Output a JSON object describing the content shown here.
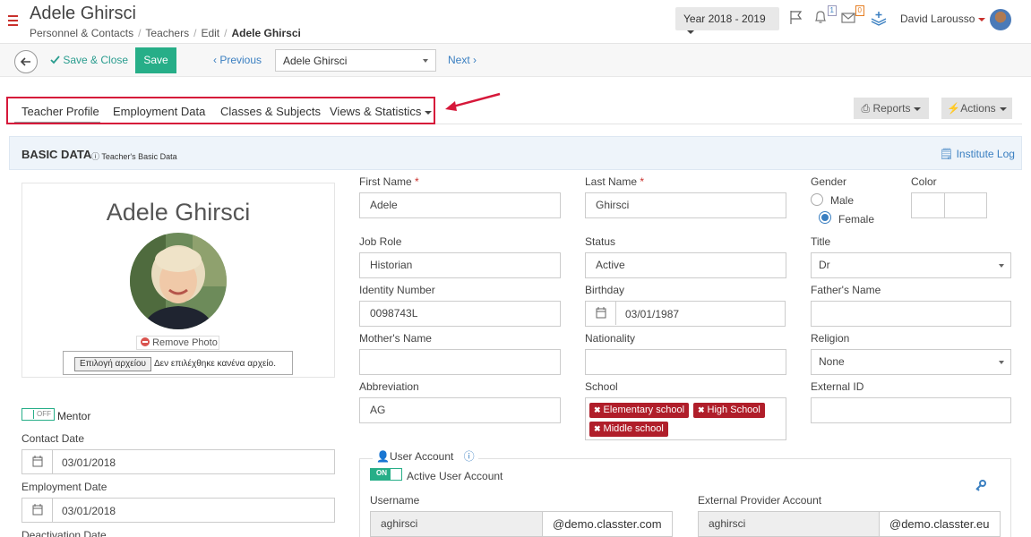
{
  "header": {
    "title": "Adele Ghirsci",
    "breadcrumb": [
      "Personnel & Contacts",
      "Teachers",
      "Edit",
      "Adele Ghirsci"
    ],
    "year_select": "Year 2018 - 2019",
    "notifications_count": "1",
    "messages_count": "0",
    "user_name": "David Larousso"
  },
  "toolbar": {
    "save_close_label": "Save & Close",
    "save_label": "Save",
    "previous_label": "Previous",
    "record_select_value": "Adele Ghirsci",
    "next_label": "Next"
  },
  "tabs": [
    {
      "label": "Teacher Profile",
      "active": true
    },
    {
      "label": "Employment Data",
      "active": false
    },
    {
      "label": "Classes & Subjects",
      "active": false
    },
    {
      "label": "Views & Statistics",
      "active": false
    }
  ],
  "buttons": {
    "reports": "Reports",
    "actions": "Actions"
  },
  "section": {
    "title": "BASIC DATA",
    "subtitle": "Teacher's Basic Data",
    "institute_log": "Institute Log"
  },
  "profile": {
    "name": "Adele Ghirsci",
    "remove_photo": "Remove Photo",
    "file_button": "Επιλογή αρχείου",
    "file_status": "Δεν επιλέχθηκε κανένα αρχείο.",
    "mentor_toggle": "OFF",
    "mentor_label": "Mentor",
    "contact_date_label": "Contact Date",
    "contact_date": "03/01/2018",
    "employment_date_label": "Employment Date",
    "employment_date": "03/01/2018",
    "deactivation_date_label": "Deactivation Date"
  },
  "form": {
    "first_name_label": "First Name",
    "first_name": "Adele",
    "last_name_label": "Last Name",
    "last_name": "Ghirsci",
    "gender_label": "Gender",
    "gender_male": "Male",
    "gender_female": "Female",
    "gender_selected": "Female",
    "color_label": "Color",
    "job_role_label": "Job Role",
    "job_role": "Historian",
    "status_label": "Status",
    "status": "Active",
    "title_label": "Title",
    "title": "Dr",
    "identity_label": "Identity Number",
    "identity": "0098743L",
    "birthday_label": "Birthday",
    "birthday": "03/01/1987",
    "fathers_name_label": "Father's Name",
    "fathers_name": "",
    "mothers_name_label": "Mother's Name",
    "mothers_name": "",
    "nationality_label": "Nationality",
    "nationality": "",
    "religion_label": "Religion",
    "religion": "None",
    "abbreviation_label": "Abbreviation",
    "abbreviation": "AG",
    "school_label": "School",
    "schools": [
      "Elementary school",
      "High School",
      "Middle school"
    ],
    "external_id_label": "External ID",
    "external_id": ""
  },
  "user_account": {
    "title": "User Account",
    "toggle": "ON",
    "active_label": "Active User Account",
    "username_label": "Username",
    "username": "aghirsci",
    "username_suffix": "@demo.classter.com",
    "external_label": "External Provider Account",
    "external_username": "aghirsci",
    "external_suffix": "@demo.classter.eu"
  },
  "colors": {
    "accent_green": "#27ae88",
    "link_blue": "#3a7fc1",
    "tag_red": "#b01e2a",
    "highlight_red": "#d6183a"
  }
}
